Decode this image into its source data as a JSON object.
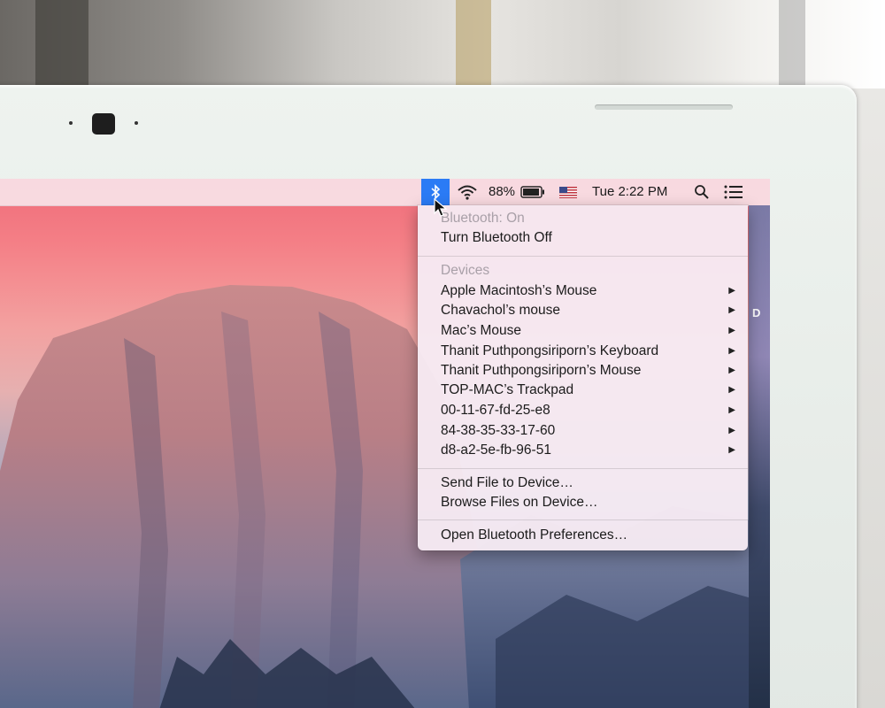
{
  "menubar": {
    "battery_percent": "88%",
    "clock": "Tue 2:22 PM"
  },
  "bluetooth_menu": {
    "status": "Bluetooth: On",
    "toggle": "Turn Bluetooth Off",
    "devices_header": "Devices",
    "devices": [
      "Apple Macintosh’s Mouse",
      "Chavachol’s mouse",
      "Mac’s Mouse",
      "Thanit Puthpongsiriporn’s Keyboard",
      "Thanit Puthpongsiriporn’s Mouse",
      "TOP-MAC’s Trackpad",
      "00-11-67-fd-25-e8",
      "84-38-35-33-17-60",
      "d8-a2-5e-fb-96-51"
    ],
    "send_file": "Send File to Device…",
    "browse_files": "Browse Files on Device…",
    "open_prefs": "Open Bluetooth Preferences…"
  },
  "background_window": {
    "edge_text": "D"
  },
  "colors": {
    "highlight": "#2b7bf5",
    "menu_bg": "#f6eaf2"
  },
  "icons": {
    "bluetooth": "bluetooth-icon",
    "wifi": "wifi-icon",
    "battery": "battery-icon",
    "flag": "us-flag-icon",
    "spotlight": "search-icon",
    "notifications": "list-icon",
    "submenu": "chevron-right-icon"
  }
}
